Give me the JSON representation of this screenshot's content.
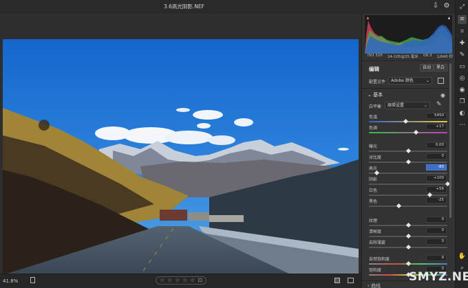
{
  "titlebar": {
    "title": "3.6高光阴影.NEF",
    "export_icon": "export-icon",
    "settings_icon": "gear-icon"
  },
  "photo": {
    "description_colors": {
      "sky": "#1f6fd0",
      "mountain_left": "#a98a3e",
      "road": "#3a4a5a"
    }
  },
  "histogram": {
    "iso": "ISO 320",
    "lens": "24-105@35 毫米",
    "aperture": "f/6.3",
    "shutter": "1/640 秒"
  },
  "edit_panel": {
    "title": "编辑",
    "auto_button": "自动",
    "bw_button": "黑白",
    "profile_label": "配置文件",
    "profile_value": "Adobe 颜色",
    "basic_section": "基本",
    "wb_label": "白平衡",
    "wb_value": "原照设置"
  },
  "sliders": {
    "color_temp": {
      "label": "色温",
      "value": "5450",
      "pos": 0.47
    },
    "tint": {
      "label": "色调",
      "value": "+17",
      "pos": 0.6
    },
    "exposure": {
      "label": "曝光",
      "value": "0.00",
      "pos": 0.5
    },
    "contrast": {
      "label": "对比度",
      "value": "0",
      "pos": 0.5
    },
    "highlights": {
      "label": "高光",
      "value": "-80",
      "pos": 0.1
    },
    "shadows": {
      "label": "阴影",
      "value": "+100",
      "pos": 1.0
    },
    "whites": {
      "label": "白色",
      "value": "+56",
      "pos": 0.78
    },
    "blacks": {
      "label": "黑色",
      "value": "-25",
      "pos": 0.38
    },
    "texture": {
      "label": "纹理",
      "value": "0",
      "pos": 0.5
    },
    "clarity": {
      "label": "清晰度",
      "value": "0",
      "pos": 0.5
    },
    "dehaze": {
      "label": "去除薄雾",
      "value": "0",
      "pos": 0.5
    },
    "vibrance": {
      "label": "自然饱和度",
      "value": "0",
      "pos": 0.5
    },
    "saturation": {
      "label": "饱和度",
      "value": "0",
      "pos": 0.5
    }
  },
  "footer": {
    "zoom": "41.8%",
    "stars": [
      "☆",
      "☆",
      "☆",
      "☆",
      "☆"
    ],
    "next_section": "曲线"
  },
  "watermark": "SMYZ.NET"
}
